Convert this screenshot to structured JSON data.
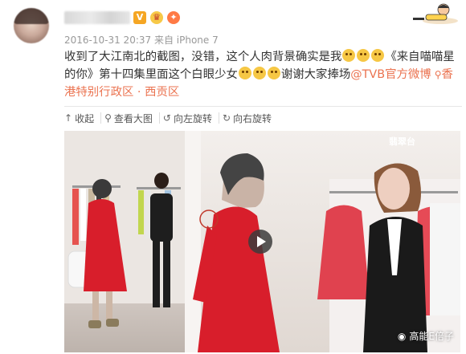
{
  "post": {
    "meta": "2016-10-31 20:37 来自 iPhone 7",
    "text_part1": "收到了大江南北的截图，没错，这个人肉背景确实是我",
    "text_part2": "《来自喵喵星的你》第十四集里面这个白眼少女",
    "text_part3": "谢谢大家捧场",
    "mention": "@TVB官方微博",
    "location": "香港特别行政区 · 西贡区"
  },
  "toolbar": {
    "collapse": "收起",
    "view_large": "查看大图",
    "rotate_left": "向左旋转",
    "rotate_right": "向右旋转"
  },
  "photo": {
    "watermark": "高能E倍子",
    "tvb_logo": "翡翠台"
  },
  "colors": {
    "link": "#eb7350",
    "text": "#333333",
    "meta": "#999999",
    "dress_red": "#d81e2b"
  }
}
